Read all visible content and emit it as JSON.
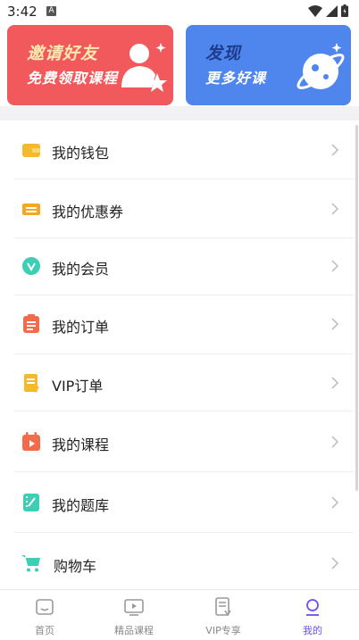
{
  "status_bar": {
    "time": "3:42",
    "indicator": "A"
  },
  "banners": {
    "invite": {
      "title": "邀请好友",
      "subtitle": "免费领取课程"
    },
    "discover": {
      "title": "发现",
      "subtitle": "更多好课"
    }
  },
  "menu": [
    {
      "label": "我的钱包",
      "icon": "wallet-icon",
      "color": "#f5b92e"
    },
    {
      "label": "我的优惠券",
      "icon": "coupon-icon",
      "color": "#f5a623"
    },
    {
      "label": "我的会员",
      "icon": "vip-member-icon",
      "color": "#3dcfb6"
    },
    {
      "label": "我的订单",
      "icon": "order-clipboard-icon",
      "color": "#f26b4a"
    },
    {
      "label": "VIP订单",
      "icon": "vip-order-icon",
      "color": "#f5b92e"
    },
    {
      "label": "我的课程",
      "icon": "course-calendar-icon",
      "color": "#f26b4a"
    },
    {
      "label": "我的题库",
      "icon": "question-bank-icon",
      "color": "#3dcfb6"
    },
    {
      "label": "购物车",
      "icon": "shopping-cart-icon",
      "color": "#3dcfb6"
    }
  ],
  "tabs": [
    {
      "label": "首页",
      "icon": "home-icon",
      "active": false
    },
    {
      "label": "精品课程",
      "icon": "video-course-icon",
      "active": false
    },
    {
      "label": "VIP专享",
      "icon": "vip-document-icon",
      "active": false
    },
    {
      "label": "我的",
      "icon": "profile-icon",
      "active": true
    }
  ],
  "colors": {
    "accent": "#6b4ff0",
    "invite_banner": "#f2595c",
    "discover_banner": "#4f86ee"
  }
}
